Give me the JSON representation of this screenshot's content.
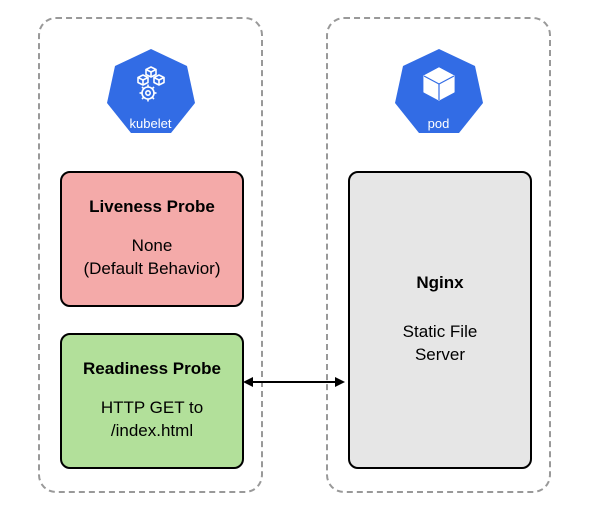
{
  "left_panel": {
    "badge_label": "kubelet",
    "liveness": {
      "title": "Liveness Probe",
      "body_line1": "None",
      "body_line2": "(Default Behavior)"
    },
    "readiness": {
      "title": "Readiness Probe",
      "body_line1": "HTTP GET to",
      "body_line2": "/index.html"
    }
  },
  "right_panel": {
    "badge_label": "pod",
    "nginx": {
      "title": "Nginx",
      "body_line1": "Static File",
      "body_line2": "Server"
    }
  },
  "colors": {
    "k8s_blue": "#326ce5",
    "liveness_bg": "#f4aaa9",
    "readiness_bg": "#b2e09a",
    "nginx_bg": "#e6e6e6"
  }
}
